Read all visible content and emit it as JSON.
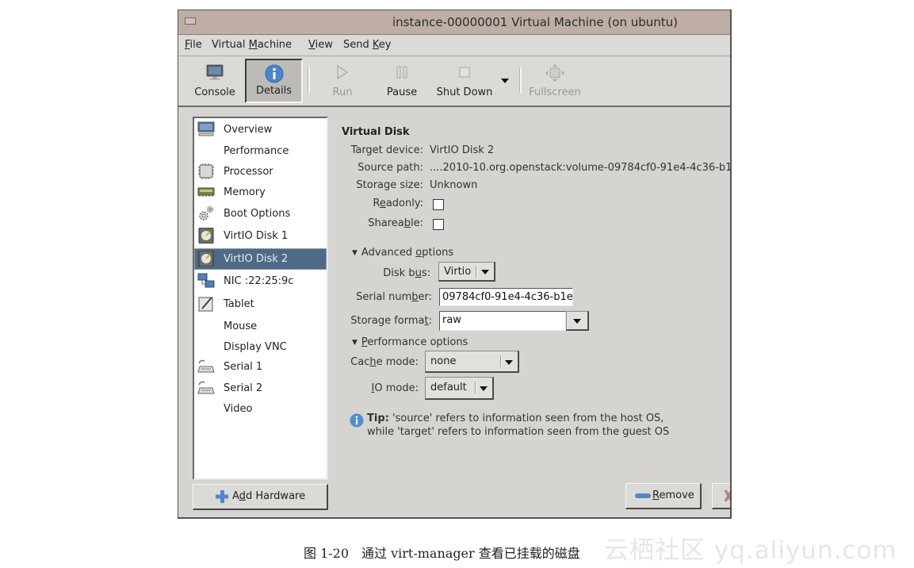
{
  "window": {
    "title": "instance-00000001 Virtual Machine (on ubuntu)"
  },
  "menubar": {
    "items": [
      {
        "label_pre": "",
        "mnemonic": "F",
        "label_post": "ile"
      },
      {
        "label_pre": "Virtual ",
        "mnemonic": "M",
        "label_post": "achine"
      },
      {
        "label_pre": "",
        "mnemonic": "V",
        "label_post": "iew"
      },
      {
        "label_pre": "Send ",
        "mnemonic": "K",
        "label_post": "ey"
      }
    ]
  },
  "toolbar": {
    "console": "Console",
    "details": "Details",
    "run": "Run",
    "pause": "Pause",
    "shutdown": "Shut Down",
    "fullscreen": "Fullscreen",
    "active": "Details"
  },
  "sidebar": {
    "items": [
      {
        "label": "Overview",
        "icon": "monitor-icon"
      },
      {
        "label": "Performance",
        "icon": ""
      },
      {
        "label": "Processor",
        "icon": "cpu-icon"
      },
      {
        "label": "Memory",
        "icon": "memory-icon"
      },
      {
        "label": "Boot Options",
        "icon": "gears-icon"
      },
      {
        "label": "VirtIO Disk 1",
        "icon": "disk-icon"
      },
      {
        "label": "VirtIO Disk 2",
        "icon": "disk-icon",
        "selected": true
      },
      {
        "label": "NIC :22:25:9c",
        "icon": "network-icon"
      },
      {
        "label": "Tablet",
        "icon": "tablet-icon"
      },
      {
        "label": "Mouse",
        "icon": ""
      },
      {
        "label": "Display VNC",
        "icon": ""
      },
      {
        "label": "Serial 1",
        "icon": "serial-icon"
      },
      {
        "label": "Serial 2",
        "icon": "serial-icon"
      },
      {
        "label": "Video",
        "icon": ""
      }
    ],
    "add_hardware": {
      "pre": "A",
      "mnemonic": "d",
      "post": "d Hardware"
    }
  },
  "details": {
    "section_title": "Virtual Disk",
    "target_device_label": "Target device:",
    "target_device": "VirtIO Disk 2",
    "source_path_label": "Source path:",
    "source_path": "....2010-10.org.openstack:volume-09784cf0-91e4-4c36-b1",
    "storage_size_label": "Storage size:",
    "storage_size": "Unknown",
    "readonly_label": {
      "pre": "R",
      "mnemonic": "e",
      "post": "adonly:"
    },
    "readonly": false,
    "shareable_label": {
      "pre": "Sharea",
      "mnemonic": "b",
      "post": "le:"
    },
    "shareable": false,
    "advanced": {
      "label": {
        "pre": "Advanced ",
        "mnemonic": "o",
        "post": "ptions"
      },
      "disk_bus_label": {
        "pre": "Disk b",
        "mnemonic": "u",
        "post": "s:"
      },
      "disk_bus": "Virtio",
      "serial_label": {
        "pre": "Serial num",
        "mnemonic": "b",
        "post": "er:"
      },
      "serial": "09784cf0-91e4-4c36-b1e",
      "storage_format_label": {
        "pre": "Storage forma",
        "mnemonic": "t",
        "post": ":"
      },
      "storage_format": "raw"
    },
    "performance": {
      "label": {
        "pre": "",
        "mnemonic": "P",
        "post": "erformance options"
      },
      "cache_mode_label": {
        "pre": "Cac",
        "mnemonic": "h",
        "post": "e mode:"
      },
      "cache_mode": "none",
      "io_mode_label": {
        "pre": "",
        "mnemonic": "I",
        "post": "O mode:"
      },
      "io_mode": "default"
    },
    "tip_bold": "Tip:",
    "tip_line1": " 'source' refers to information seen from the host OS,",
    "tip_line2": "while 'target' refers to information seen from the guest OS"
  },
  "buttons": {
    "remove": {
      "pre": "",
      "mnemonic": "R",
      "post": "emove"
    }
  },
  "caption": "图 1-20　通过 virt-manager 查看已挂载的磁盘",
  "watermark": "云栖社区 yq.aliyun.com"
}
